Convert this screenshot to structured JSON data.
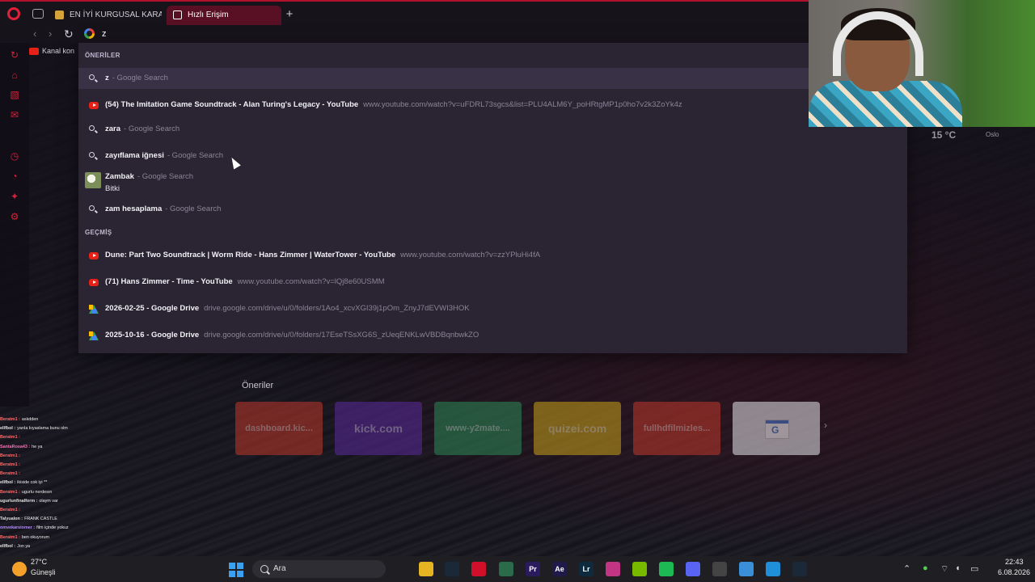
{
  "browser": {
    "tabs": [
      {
        "label": "EN İYİ KURGUSAL KARAKT"
      },
      {
        "label": "Hızlı Erişim"
      }
    ],
    "address_value": "z",
    "bookmark_label": "Kanal kon"
  },
  "dropdown": {
    "suggestions_label": "ÖNERİLER",
    "history_label": "GEÇMİŞ",
    "suggestions": [
      {
        "main": "z",
        "sub": "- Google Search",
        "icon": "search-icon"
      },
      {
        "main": "(54) The Imitation Game Soundtrack - Alan Turing's Legacy - YouTube",
        "url": "www.youtube.com/watch?v=uFDRL73sgcs&list=PLU4ALM6Y_poHRtgMP1p0ho7v2k3ZoYk4z",
        "icon": "youtube-icon"
      },
      {
        "main": "zara",
        "sub": "- Google Search",
        "icon": "search-icon"
      },
      {
        "main": "zayıflama iğnesi",
        "sub": "- Google Search",
        "icon": "search-icon"
      },
      {
        "main": "Zambak",
        "sub": "- Google Search",
        "line2": "Bitki",
        "icon": "flower-thumbnail"
      },
      {
        "main": "zam hesaplama",
        "sub": "- Google Search",
        "icon": "search-icon"
      }
    ],
    "history": [
      {
        "main": "Dune: Part Two Soundtrack | Worm Ride - Hans Zimmer | WaterTower - YouTube",
        "url": "www.youtube.com/watch?v=zzYPluHi4fA",
        "icon": "youtube-icon"
      },
      {
        "main": "(71) Hans Zimmer - Time - YouTube",
        "url": "www.youtube.com/watch?v=lQj8e60USMM",
        "icon": "youtube-icon"
      },
      {
        "main": "2026-02-25 - Google Drive",
        "url": "drive.google.com/drive/u/0/folders/1Ao4_xcvXGI39j1pOm_ZnyJ7dEVWI3HOK",
        "icon": "google-drive-icon"
      },
      {
        "main": "2025-10-16 - Google Drive",
        "url": "drive.google.com/drive/u/0/folders/17EseTSsXG6S_zUeqENKLwVBDBqnbwkZO",
        "icon": "google-drive-icon"
      }
    ]
  },
  "weather_widget": {
    "temp": "15 °C",
    "city": "Oslo"
  },
  "speed_dial": {
    "title": "Öneriler",
    "tiles": [
      {
        "label": "dashboard.kic...",
        "color": "#c0392b"
      },
      {
        "label": "kick.com",
        "color": "#5b2a9e"
      },
      {
        "label": "www-y2mate....",
        "color": "#2e8b57"
      },
      {
        "label": "quizei.com",
        "color": "#c9a21a"
      },
      {
        "label": "fullhdfilmizles...",
        "color": "#c0392b"
      },
      {
        "label": "",
        "color": "#e6e6ea"
      }
    ]
  },
  "chat": [
    {
      "user": "Beratm1 :",
      "msg": "askdden",
      "color": "#ff6b6b"
    },
    {
      "user": "ellfbol :",
      "msg": "yarıla kıyaslama bunu olm",
      "color": "#e0e0e0"
    },
    {
      "user": "Beratm1 :",
      "msg": "",
      "color": "#ff6b6b"
    },
    {
      "user": "SantaRosa43 :",
      "msg": "he ya",
      "color": "#ff6bb5"
    },
    {
      "user": "Beratm1 :",
      "msg": "",
      "color": "#ff6b6b"
    },
    {
      "user": "Beratm1 :",
      "msg": "",
      "color": "#ff6b6b"
    },
    {
      "user": "Beratm1 :",
      "msg": "",
      "color": "#ff6b6b"
    },
    {
      "user": "ellfbol :",
      "msg": "ikiside cok iyi **",
      "color": "#e0e0e0"
    },
    {
      "user": "Beratm1 :",
      "msg": "ugurlu nerdesın",
      "color": "#ff6b6b"
    },
    {
      "user": "ugurlunfinalform :",
      "msg": "olaym var",
      "color": "#e0e0e0"
    },
    {
      "user": "Beratm1 :",
      "msg": "",
      "color": "#ff6b6b"
    },
    {
      "user": "Talyualon :",
      "msg": "FRANK CASTLE",
      "color": "#e0e0e0"
    },
    {
      "user": "omvekarsiomer :",
      "msg": "film içinde yokuz",
      "color": "#b38cff"
    },
    {
      "user": "Beratm1 :",
      "msg": "ben okuyorum",
      "color": "#ff6b6b"
    },
    {
      "user": "ellfbol :",
      "msg": "Jon ya",
      "color": "#e0e0e0"
    }
  ],
  "taskbar": {
    "weather_temp": "27°C",
    "weather_desc": "Güneşli",
    "search_label": "Ara",
    "apps": [
      {
        "name": "file-explorer-icon",
        "glyph": "",
        "color": "#e6b422"
      },
      {
        "name": "steam-icon",
        "glyph": "",
        "color": "#1b2838"
      },
      {
        "name": "opera-icon",
        "glyph": "",
        "color": "#d0102a"
      },
      {
        "name": "app-icon",
        "glyph": "",
        "color": "#2a6b4a"
      },
      {
        "name": "premiere-icon",
        "glyph": "Pr",
        "color": "#2a1a5e"
      },
      {
        "name": "after-effects-icon",
        "glyph": "Ae",
        "color": "#1f1a4a"
      },
      {
        "name": "lightroom-icon",
        "glyph": "Lr",
        "color": "#0d2a3e"
      },
      {
        "name": "instagram-icon",
        "glyph": "",
        "color": "#c13584"
      },
      {
        "name": "nvidia-icon",
        "glyph": "",
        "color": "#76b900"
      },
      {
        "name": "spotify-icon",
        "glyph": "",
        "color": "#1db954"
      },
      {
        "name": "discord-icon",
        "glyph": "",
        "color": "#5865f2"
      },
      {
        "name": "chatgpt-icon",
        "glyph": "",
        "color": "#444"
      },
      {
        "name": "app2-icon",
        "glyph": "",
        "color": "#3a8fd8"
      },
      {
        "name": "edge-icon",
        "glyph": "",
        "color": "#1f8fd8"
      },
      {
        "name": "steam2-icon",
        "glyph": "",
        "color": "#1b2838"
      }
    ],
    "time": "22:43",
    "date": "6.08.2026"
  }
}
